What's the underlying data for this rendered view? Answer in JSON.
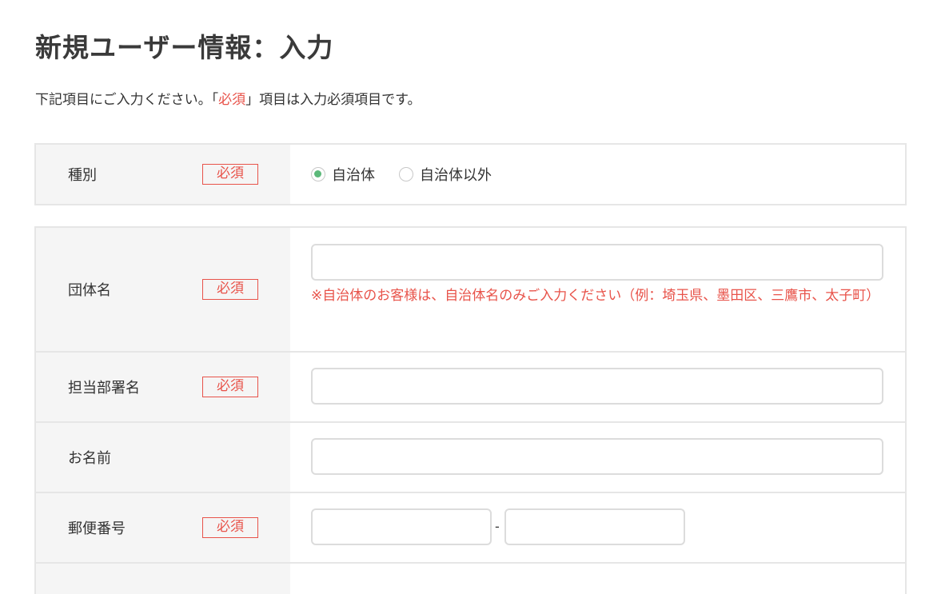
{
  "page": {
    "title": "新規ユーザー情報：入力",
    "intro_before": "下記項目にご入力ください。「",
    "intro_required": "必須",
    "intro_after": "」項目は入力必須項目です。"
  },
  "fields": {
    "type": {
      "label": "種別",
      "required_badge": "必須",
      "options": [
        {
          "label": "自治体",
          "selected": true
        },
        {
          "label": "自治体以外",
          "selected": false
        }
      ]
    },
    "org_name": {
      "label": "団体名",
      "required_badge": "必須",
      "value": "",
      "placeholder": "",
      "note": "※自治体のお客様は、自治体名のみご入力ください（例：埼玉県、墨田区、三鷹市、太子町）"
    },
    "department": {
      "label": "担当部署名",
      "required_badge": "必須",
      "value": "",
      "placeholder": ""
    },
    "name": {
      "label": "お名前",
      "value": "",
      "placeholder": ""
    },
    "postal_code": {
      "label": "郵便番号",
      "required_badge": "必須",
      "part1": "",
      "separator": "-",
      "part2": ""
    }
  },
  "colors": {
    "required": "#e8534a",
    "radio_selected": "#5cb97a",
    "label_bg": "#f5f5f5",
    "border": "#e6e6e6"
  }
}
